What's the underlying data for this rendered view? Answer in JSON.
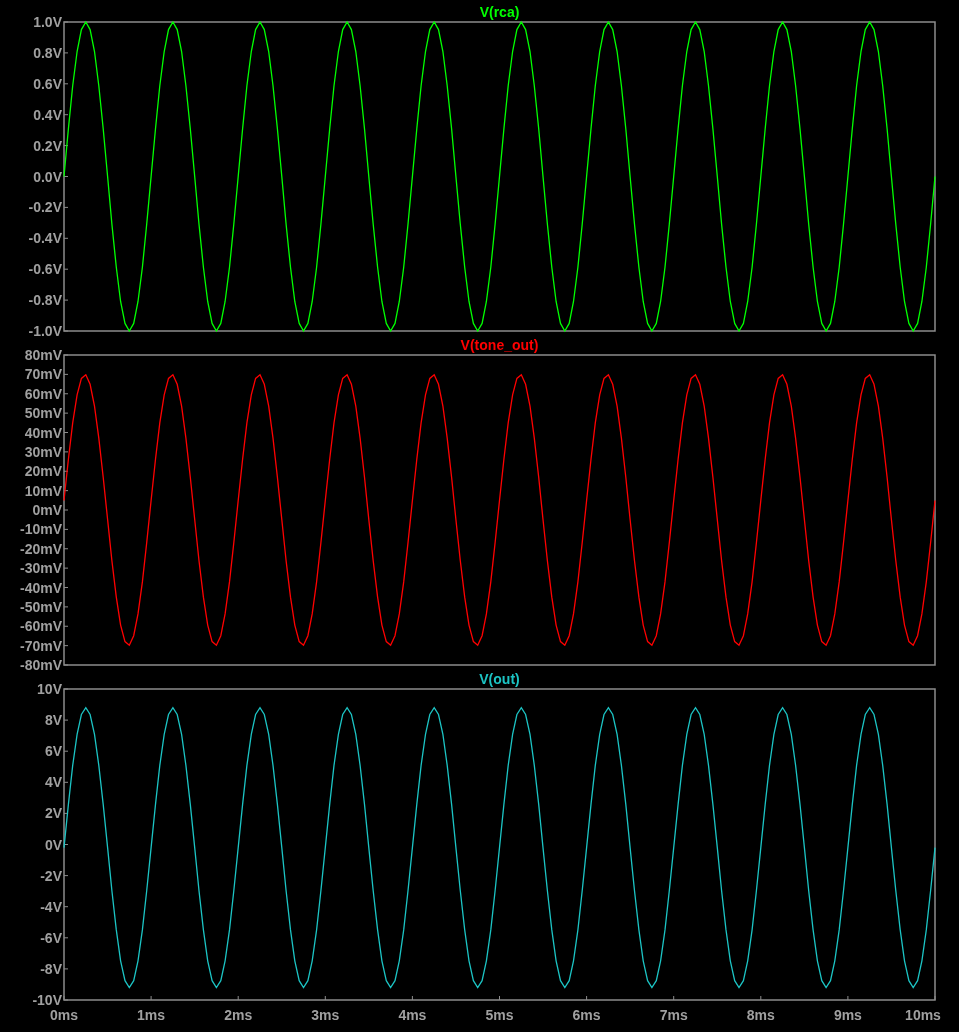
{
  "plots": [
    {
      "chart_data": {
        "type": "line",
        "xlim": [
          0,
          10
        ],
        "ylim": [
          -1,
          1
        ],
        "yticks": [
          {
            "value": 1,
            "label": "1.0V"
          },
          {
            "value": 0.8,
            "label": "0.8V"
          },
          {
            "value": 0.6,
            "label": "0.6V"
          },
          {
            "value": 0.4,
            "label": "0.4V"
          },
          {
            "value": 0.2,
            "label": "0.2V"
          },
          {
            "value": 0,
            "label": "0.0V"
          },
          {
            "value": -0.2,
            "label": "-0.2V"
          },
          {
            "value": -0.4,
            "label": "-0.4V"
          },
          {
            "value": -0.6,
            "label": "-0.6V"
          },
          {
            "value": -0.8,
            "label": "-0.8V"
          },
          {
            "value": -1,
            "label": "-1.0V"
          }
        ],
        "x": [
          0,
          0.05,
          0.1,
          0.15,
          0.2,
          0.25,
          0.3,
          0.35,
          0.4,
          0.45,
          0.5,
          0.55,
          0.6,
          0.65,
          0.7,
          0.75,
          0.8,
          0.85,
          0.9,
          0.95,
          1,
          1.05,
          1.1,
          1.15,
          1.2,
          1.25,
          1.3,
          1.35,
          1.4,
          1.45,
          1.5,
          1.55,
          1.6,
          1.65,
          1.7,
          1.75,
          1.8,
          1.85,
          1.9,
          1.95,
          2,
          2.05,
          2.1,
          2.15,
          2.2,
          2.25,
          2.3,
          2.35,
          2.4,
          2.45,
          2.5,
          2.55,
          2.6,
          2.65,
          2.7,
          2.75,
          2.8,
          2.85,
          2.9,
          2.95,
          3,
          3.05,
          3.1,
          3.15,
          3.2,
          3.25,
          3.3,
          3.35,
          3.4,
          3.45,
          3.5,
          3.55,
          3.6,
          3.65,
          3.7,
          3.75,
          3.8,
          3.85,
          3.9,
          3.95,
          4,
          4.05,
          4.1,
          4.15,
          4.2,
          4.25,
          4.3,
          4.35,
          4.4,
          4.45,
          4.5,
          4.55,
          4.6,
          4.65,
          4.7,
          4.75,
          4.8,
          4.85,
          4.9,
          4.95,
          5,
          5.05,
          5.1,
          5.15,
          5.2,
          5.25,
          5.3,
          5.35,
          5.4,
          5.45,
          5.5,
          5.55,
          5.6,
          5.65,
          5.7,
          5.75,
          5.8,
          5.85,
          5.9,
          5.95,
          6,
          6.05,
          6.1,
          6.15,
          6.2,
          6.25,
          6.3,
          6.35,
          6.4,
          6.45,
          6.5,
          6.55,
          6.6,
          6.65,
          6.7,
          6.75,
          6.8,
          6.85,
          6.9,
          6.95,
          7,
          7.05,
          7.1,
          7.15,
          7.2,
          7.25,
          7.3,
          7.35,
          7.4,
          7.45,
          7.5,
          7.55,
          7.6,
          7.65,
          7.7,
          7.75,
          7.8,
          7.85,
          7.9,
          7.95,
          8,
          8.05,
          8.1,
          8.15,
          8.2,
          8.25,
          8.3,
          8.35,
          8.4,
          8.45,
          8.5,
          8.55,
          8.6,
          8.65,
          8.7,
          8.75,
          8.8,
          8.85,
          8.9,
          8.95,
          9,
          9.05,
          9.1,
          9.15,
          9.2,
          9.25,
          9.3,
          9.35,
          9.4,
          9.45,
          9.5,
          9.55,
          9.6,
          9.65,
          9.7,
          9.75,
          9.8,
          9.85,
          9.9,
          9.95,
          10
        ],
        "series": [
          {
            "name": "V(rca)",
            "color": "#00ff00",
            "values": [
              0,
              0.309,
              0.588,
              0.809,
              0.951,
              1,
              0.951,
              0.809,
              0.588,
              0.309,
              0,
              -0.309,
              -0.588,
              -0.809,
              -0.951,
              -1,
              -0.951,
              -0.809,
              -0.588,
              -0.309,
              0,
              0.309,
              0.588,
              0.809,
              0.951,
              1,
              0.951,
              0.809,
              0.588,
              0.309,
              0,
              -0.309,
              -0.588,
              -0.809,
              -0.951,
              -1,
              -0.951,
              -0.809,
              -0.588,
              -0.309,
              0,
              0.309,
              0.588,
              0.809,
              0.951,
              1,
              0.951,
              0.809,
              0.588,
              0.309,
              0,
              -0.309,
              -0.588,
              -0.809,
              -0.951,
              -1,
              -0.951,
              -0.809,
              -0.588,
              -0.309,
              0,
              0.309,
              0.588,
              0.809,
              0.951,
              1,
              0.951,
              0.809,
              0.588,
              0.309,
              0,
              -0.309,
              -0.588,
              -0.809,
              -0.951,
              -1,
              -0.951,
              -0.809,
              -0.588,
              -0.309,
              0,
              0.309,
              0.588,
              0.809,
              0.951,
              1,
              0.951,
              0.809,
              0.588,
              0.309,
              0,
              -0.309,
              -0.588,
              -0.809,
              -0.951,
              -1,
              -0.951,
              -0.809,
              -0.588,
              -0.309,
              0,
              0.309,
              0.588,
              0.809,
              0.951,
              1,
              0.951,
              0.809,
              0.588,
              0.309,
              0,
              -0.309,
              -0.588,
              -0.809,
              -0.951,
              -1,
              -0.951,
              -0.809,
              -0.588,
              -0.309,
              0,
              0.309,
              0.588,
              0.809,
              0.951,
              1,
              0.951,
              0.809,
              0.588,
              0.309,
              0,
              -0.309,
              -0.588,
              -0.809,
              -0.951,
              -1,
              -0.951,
              -0.809,
              -0.588,
              -0.309,
              0,
              0.309,
              0.588,
              0.809,
              0.951,
              1,
              0.951,
              0.809,
              0.588,
              0.309,
              0,
              -0.309,
              -0.588,
              -0.809,
              -0.951,
              -1,
              -0.951,
              -0.809,
              -0.588,
              -0.309,
              0,
              0.309,
              0.588,
              0.809,
              0.951,
              1,
              0.951,
              0.809,
              0.588,
              0.309,
              0,
              -0.309,
              -0.588,
              -0.809,
              -0.951,
              -1,
              -0.951,
              -0.809,
              -0.588,
              -0.309,
              0,
              0.309,
              0.588,
              0.809,
              0.951,
              1,
              0.951,
              0.809,
              0.588,
              0.309,
              0,
              -0.309,
              -0.588,
              -0.809,
              -0.951,
              -1,
              -0.951,
              -0.809,
              -0.588,
              -0.309,
              0
            ]
          }
        ]
      }
    },
    {
      "chart_data": {
        "type": "line",
        "xlim": [
          0,
          10
        ],
        "ylim": [
          -80,
          80
        ],
        "yticks": [
          {
            "value": 80,
            "label": "80mV"
          },
          {
            "value": 70,
            "label": "70mV"
          },
          {
            "value": 60,
            "label": "60mV"
          },
          {
            "value": 50,
            "label": "50mV"
          },
          {
            "value": 40,
            "label": "40mV"
          },
          {
            "value": 30,
            "label": "30mV"
          },
          {
            "value": 20,
            "label": "20mV"
          },
          {
            "value": 10,
            "label": "10mV"
          },
          {
            "value": 0,
            "label": "0mV"
          },
          {
            "value": -10,
            "label": "-10mV"
          },
          {
            "value": -20,
            "label": "-20mV"
          },
          {
            "value": -30,
            "label": "-30mV"
          },
          {
            "value": -40,
            "label": "-40mV"
          },
          {
            "value": -50,
            "label": "-50mV"
          },
          {
            "value": -60,
            "label": "-60mV"
          },
          {
            "value": -70,
            "label": "-70mV"
          },
          {
            "value": -80,
            "label": "-80mV"
          }
        ],
        "x": [
          0,
          0.05,
          0.1,
          0.15,
          0.2,
          0.25,
          0.3,
          0.35,
          0.4,
          0.45,
          0.5,
          0.55,
          0.6,
          0.65,
          0.7,
          0.75,
          0.8,
          0.85,
          0.9,
          0.95,
          1,
          1.05,
          1.1,
          1.15,
          1.2,
          1.25,
          1.3,
          1.35,
          1.4,
          1.45,
          1.5,
          1.55,
          1.6,
          1.65,
          1.7,
          1.75,
          1.8,
          1.85,
          1.9,
          1.95,
          2,
          2.05,
          2.1,
          2.15,
          2.2,
          2.25,
          2.3,
          2.35,
          2.4,
          2.45,
          2.5,
          2.55,
          2.6,
          2.65,
          2.7,
          2.75,
          2.8,
          2.85,
          2.9,
          2.95,
          3,
          3.05,
          3.1,
          3.15,
          3.2,
          3.25,
          3.3,
          3.35,
          3.4,
          3.45,
          3.5,
          3.55,
          3.6,
          3.65,
          3.7,
          3.75,
          3.8,
          3.85,
          3.9,
          3.95,
          4,
          4.05,
          4.1,
          4.15,
          4.2,
          4.25,
          4.3,
          4.35,
          4.4,
          4.45,
          4.5,
          4.55,
          4.6,
          4.65,
          4.7,
          4.75,
          4.8,
          4.85,
          4.9,
          4.95,
          5,
          5.05,
          5.1,
          5.15,
          5.2,
          5.25,
          5.3,
          5.35,
          5.4,
          5.45,
          5.5,
          5.55,
          5.6,
          5.65,
          5.7,
          5.75,
          5.8,
          5.85,
          5.9,
          5.95,
          6,
          6.05,
          6.1,
          6.15,
          6.2,
          6.25,
          6.3,
          6.35,
          6.4,
          6.45,
          6.5,
          6.55,
          6.6,
          6.65,
          6.7,
          6.75,
          6.8,
          6.85,
          6.9,
          6.95,
          7,
          7.05,
          7.1,
          7.15,
          7.2,
          7.25,
          7.3,
          7.35,
          7.4,
          7.45,
          7.5,
          7.55,
          7.6,
          7.65,
          7.7,
          7.75,
          7.8,
          7.85,
          7.9,
          7.95,
          8,
          8.05,
          8.1,
          8.15,
          8.2,
          8.25,
          8.3,
          8.35,
          8.4,
          8.45,
          8.5,
          8.55,
          8.6,
          8.65,
          8.7,
          8.75,
          8.8,
          8.85,
          8.9,
          8.95,
          9,
          9.05,
          9.1,
          9.15,
          9.2,
          9.25,
          9.3,
          9.35,
          9.4,
          9.45,
          9.5,
          9.55,
          9.6,
          9.65,
          9.7,
          9.75,
          9.8,
          9.85,
          9.9,
          9.95,
          10
        ],
        "series": [
          {
            "name": "V(tone_out)",
            "color": "#ff0000",
            "values": [
              4.9,
              26.2,
              45,
              59.4,
              67.9,
              69.8,
              64.9,
              53.6,
              37.1,
              16.9,
              -4.9,
              -26.2,
              -45,
              -59.4,
              -67.9,
              -69.8,
              -64.9,
              -53.6,
              -37.1,
              -16.9,
              4.9,
              26.2,
              45,
              59.4,
              67.9,
              69.8,
              64.9,
              53.6,
              37.1,
              16.9,
              -4.9,
              -26.2,
              -45,
              -59.4,
              -67.9,
              -69.8,
              -64.9,
              -53.6,
              -37.1,
              -16.9,
              4.9,
              26.2,
              45,
              59.4,
              67.9,
              69.8,
              64.9,
              53.6,
              37.1,
              16.9,
              -4.9,
              -26.2,
              -45,
              -59.4,
              -67.9,
              -69.8,
              -64.9,
              -53.6,
              -37.1,
              -16.9,
              4.9,
              26.2,
              45,
              59.4,
              67.9,
              69.8,
              64.9,
              53.6,
              37.1,
              16.9,
              -4.9,
              -26.2,
              -45,
              -59.4,
              -67.9,
              -69.8,
              -64.9,
              -53.6,
              -37.1,
              -16.9,
              4.9,
              26.2,
              45,
              59.4,
              67.9,
              69.8,
              64.9,
              53.6,
              37.1,
              16.9,
              -4.9,
              -26.2,
              -45,
              -59.4,
              -67.9,
              -69.8,
              -64.9,
              -53.6,
              -37.1,
              -16.9,
              4.9,
              26.2,
              45,
              59.4,
              67.9,
              69.8,
              64.9,
              53.6,
              37.1,
              16.9,
              -4.9,
              -26.2,
              -45,
              -59.4,
              -67.9,
              -69.8,
              -64.9,
              -53.6,
              -37.1,
              -16.9,
              4.9,
              26.2,
              45,
              59.4,
              67.9,
              69.8,
              64.9,
              53.6,
              37.1,
              16.9,
              -4.9,
              -26.2,
              -45,
              -59.4,
              -67.9,
              -69.8,
              -64.9,
              -53.6,
              -37.1,
              -16.9,
              4.9,
              26.2,
              45,
              59.4,
              67.9,
              69.8,
              64.9,
              53.6,
              37.1,
              16.9,
              -4.9,
              -26.2,
              -45,
              -59.4,
              -67.9,
              -69.8,
              -64.9,
              -53.6,
              -37.1,
              -16.9,
              4.9,
              26.2,
              45,
              59.4,
              67.9,
              69.8,
              64.9,
              53.6,
              37.1,
              16.9,
              -4.9,
              -26.2,
              -45,
              -59.4,
              -67.9,
              -69.8,
              -64.9,
              -53.6,
              -37.1,
              -16.9,
              4.9,
              26.2,
              45,
              59.4,
              67.9,
              69.8,
              64.9,
              53.6,
              37.1,
              16.9,
              -4.9,
              -26.2,
              -45,
              -59.4,
              -67.9,
              -69.8,
              -64.9,
              -53.6,
              -37.1,
              -16.9,
              4.9
            ]
          }
        ]
      }
    },
    {
      "chart_data": {
        "type": "line",
        "xlim": [
          0,
          10
        ],
        "ylim": [
          -10,
          10
        ],
        "yticks": [
          {
            "value": 10,
            "label": "10V"
          },
          {
            "value": 8,
            "label": "8V"
          },
          {
            "value": 6,
            "label": "6V"
          },
          {
            "value": 4,
            "label": "4V"
          },
          {
            "value": 2,
            "label": "2V"
          },
          {
            "value": 0,
            "label": "0V"
          },
          {
            "value": -2,
            "label": "-2V"
          },
          {
            "value": -4,
            "label": "-4V"
          },
          {
            "value": -6,
            "label": "-6V"
          },
          {
            "value": -8,
            "label": "-8V"
          },
          {
            "value": -10,
            "label": "-10V"
          }
        ],
        "xticks": [
          {
            "value": 0,
            "label": "0ms"
          },
          {
            "value": 1,
            "label": "1ms"
          },
          {
            "value": 2,
            "label": "2ms"
          },
          {
            "value": 3,
            "label": "3ms"
          },
          {
            "value": 4,
            "label": "4ms"
          },
          {
            "value": 5,
            "label": "5ms"
          },
          {
            "value": 6,
            "label": "6ms"
          },
          {
            "value": 7,
            "label": "7ms"
          },
          {
            "value": 8,
            "label": "8ms"
          },
          {
            "value": 9,
            "label": "9ms"
          },
          {
            "value": 10,
            "label": "10ms"
          }
        ],
        "x": [
          0,
          0.05,
          0.1,
          0.15,
          0.2,
          0.25,
          0.3,
          0.35,
          0.4,
          0.45,
          0.5,
          0.55,
          0.6,
          0.65,
          0.7,
          0.75,
          0.8,
          0.85,
          0.9,
          0.95,
          1,
          1.05,
          1.1,
          1.15,
          1.2,
          1.25,
          1.3,
          1.35,
          1.4,
          1.45,
          1.5,
          1.55,
          1.6,
          1.65,
          1.7,
          1.75,
          1.8,
          1.85,
          1.9,
          1.95,
          2,
          2.05,
          2.1,
          2.15,
          2.2,
          2.25,
          2.3,
          2.35,
          2.4,
          2.45,
          2.5,
          2.55,
          2.6,
          2.65,
          2.7,
          2.75,
          2.8,
          2.85,
          2.9,
          2.95,
          3,
          3.05,
          3.1,
          3.15,
          3.2,
          3.25,
          3.3,
          3.35,
          3.4,
          3.45,
          3.5,
          3.55,
          3.6,
          3.65,
          3.7,
          3.75,
          3.8,
          3.85,
          3.9,
          3.95,
          4,
          4.05,
          4.1,
          4.15,
          4.2,
          4.25,
          4.3,
          4.35,
          4.4,
          4.45,
          4.5,
          4.55,
          4.6,
          4.65,
          4.7,
          4.75,
          4.8,
          4.85,
          4.9,
          4.95,
          5,
          5.05,
          5.1,
          5.15,
          5.2,
          5.25,
          5.3,
          5.35,
          5.4,
          5.45,
          5.5,
          5.55,
          5.6,
          5.65,
          5.7,
          5.75,
          5.8,
          5.85,
          5.9,
          5.95,
          6,
          6.05,
          6.1,
          6.15,
          6.2,
          6.25,
          6.3,
          6.35,
          6.4,
          6.45,
          6.5,
          6.55,
          6.6,
          6.65,
          6.7,
          6.75,
          6.8,
          6.85,
          6.9,
          6.95,
          7,
          7.05,
          7.1,
          7.15,
          7.2,
          7.25,
          7.3,
          7.35,
          7.4,
          7.45,
          7.5,
          7.55,
          7.6,
          7.65,
          7.7,
          7.75,
          7.8,
          7.85,
          7.9,
          7.95,
          8,
          8.05,
          8.1,
          8.15,
          8.2,
          8.25,
          8.3,
          8.35,
          8.4,
          8.45,
          8.5,
          8.55,
          8.6,
          8.65,
          8.7,
          8.75,
          8.8,
          8.85,
          8.9,
          8.95,
          9,
          9.05,
          9.1,
          9.15,
          9.2,
          9.25,
          9.3,
          9.35,
          9.4,
          9.45,
          9.5,
          9.55,
          9.6,
          9.65,
          9.7,
          9.75,
          9.8,
          9.85,
          9.9,
          9.95,
          10
        ],
        "series": [
          {
            "name": "V(out)",
            "color": "#1cc4c4",
            "values": [
              -0.2,
              2.58,
              5.09,
              7.08,
              8.36,
              8.8,
              8.36,
              7.08,
              5.09,
              2.58,
              -0.2,
              -2.98,
              -5.49,
              -7.48,
              -8.76,
              -9.2,
              -8.76,
              -7.48,
              -5.49,
              -2.98,
              -0.2,
              2.58,
              5.09,
              7.08,
              8.36,
              8.8,
              8.36,
              7.08,
              5.09,
              2.58,
              -0.2,
              -2.98,
              -5.49,
              -7.48,
              -8.76,
              -9.2,
              -8.76,
              -7.48,
              -5.49,
              -2.98,
              -0.2,
              2.58,
              5.09,
              7.08,
              8.36,
              8.8,
              8.36,
              7.08,
              5.09,
              2.58,
              -0.2,
              -2.98,
              -5.49,
              -7.48,
              -8.76,
              -9.2,
              -8.76,
              -7.48,
              -5.49,
              -2.98,
              -0.2,
              2.58,
              5.09,
              7.08,
              8.36,
              8.8,
              8.36,
              7.08,
              5.09,
              2.58,
              -0.2,
              -2.98,
              -5.49,
              -7.48,
              -8.76,
              -9.2,
              -8.76,
              -7.48,
              -5.49,
              -2.98,
              -0.2,
              2.58,
              5.09,
              7.08,
              8.36,
              8.8,
              8.36,
              7.08,
              5.09,
              2.58,
              -0.2,
              -2.98,
              -5.49,
              -7.48,
              -8.76,
              -9.2,
              -8.76,
              -7.48,
              -5.49,
              -2.98,
              -0.2,
              2.58,
              5.09,
              7.08,
              8.36,
              8.8,
              8.36,
              7.08,
              5.09,
              2.58,
              -0.2,
              -2.98,
              -5.49,
              -7.48,
              -8.76,
              -9.2,
              -8.76,
              -7.48,
              -5.49,
              -2.98,
              -0.2,
              2.58,
              5.09,
              7.08,
              8.36,
              8.8,
              8.36,
              7.08,
              5.09,
              2.58,
              -0.2,
              -2.98,
              -5.49,
              -7.48,
              -8.76,
              -9.2,
              -8.76,
              -7.48,
              -5.49,
              -2.98,
              -0.2,
              2.58,
              5.09,
              7.08,
              8.36,
              8.8,
              8.36,
              7.08,
              5.09,
              2.58,
              -0.2,
              -2.98,
              -5.49,
              -7.48,
              -8.76,
              -9.2,
              -8.76,
              -7.48,
              -5.49,
              -2.98,
              -0.2,
              2.58,
              5.09,
              7.08,
              8.36,
              8.8,
              8.36,
              7.08,
              5.09,
              2.58,
              -0.2,
              -2.98,
              -5.49,
              -7.48,
              -8.76,
              -9.2,
              -8.76,
              -7.48,
              -5.49,
              -2.98,
              -0.2,
              2.58,
              5.09,
              7.08,
              8.36,
              8.8,
              8.36,
              7.08,
              5.09,
              2.58,
              -0.2,
              -2.98,
              -5.49,
              -7.48,
              -8.76,
              -9.2,
              -8.76,
              -7.48,
              -5.49,
              -2.98,
              -0.2
            ]
          }
        ]
      }
    }
  ]
}
